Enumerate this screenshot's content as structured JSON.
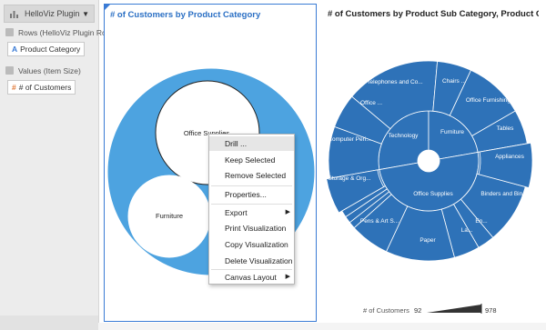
{
  "sidebar": {
    "plugin_label": "HelloViz Plugin",
    "rows_label": "Rows (HelloViz Plugin Rows)",
    "rows_pill": "Product Category",
    "values_label": "Values (Item Size)",
    "values_pill": "# of Customers",
    "rows_pill_icon": "A",
    "values_pill_icon": "#"
  },
  "viz1": {
    "title": "# of Customers by Product Category",
    "circles": [
      "Office Supplies",
      "Furniture"
    ]
  },
  "viz2": {
    "title": "# of Customers by Product Sub Category, Product Ca...",
    "inner": [
      "Technology",
      "Furniture",
      "Office Supplies"
    ],
    "outer": [
      "Telephones and Co...",
      "Chairs ...",
      "Office Furnishings",
      "Tables",
      "Appliances",
      "Binders and Bin...",
      "En...",
      "La...",
      "Paper",
      "Pens & Art S...",
      "Storage & Org...",
      "Computer Peri...",
      "Office ..."
    ]
  },
  "menu": {
    "items": [
      "Drill ...",
      "Keep Selected",
      "Remove Selected",
      "Properties...",
      "Export",
      "Print Visualization",
      "Copy Visualization",
      "Delete Visualization",
      "Canvas Layout"
    ]
  },
  "legend": {
    "label": "# of Customers",
    "min": "92",
    "max": "978"
  },
  "colors": {
    "accent": "#3a7bd5",
    "sunburst": "#2e72b8",
    "pack_outer": "#4da3e0"
  }
}
